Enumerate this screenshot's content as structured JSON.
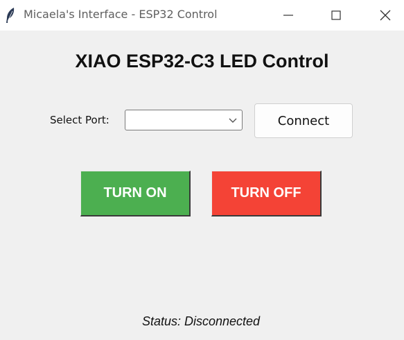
{
  "window": {
    "title": "Micaela's Interface - ESP32 Control",
    "icon": "feather-icon"
  },
  "main": {
    "heading": "XIAO ESP32-C3 LED Control",
    "port_label": "Select Port:",
    "port_value": "",
    "connect_label": "Connect",
    "on_label": "TURN ON",
    "off_label": "TURN OFF",
    "status": "Status: Disconnected"
  },
  "colors": {
    "on_button": "#4caf50",
    "off_button": "#f44336"
  }
}
